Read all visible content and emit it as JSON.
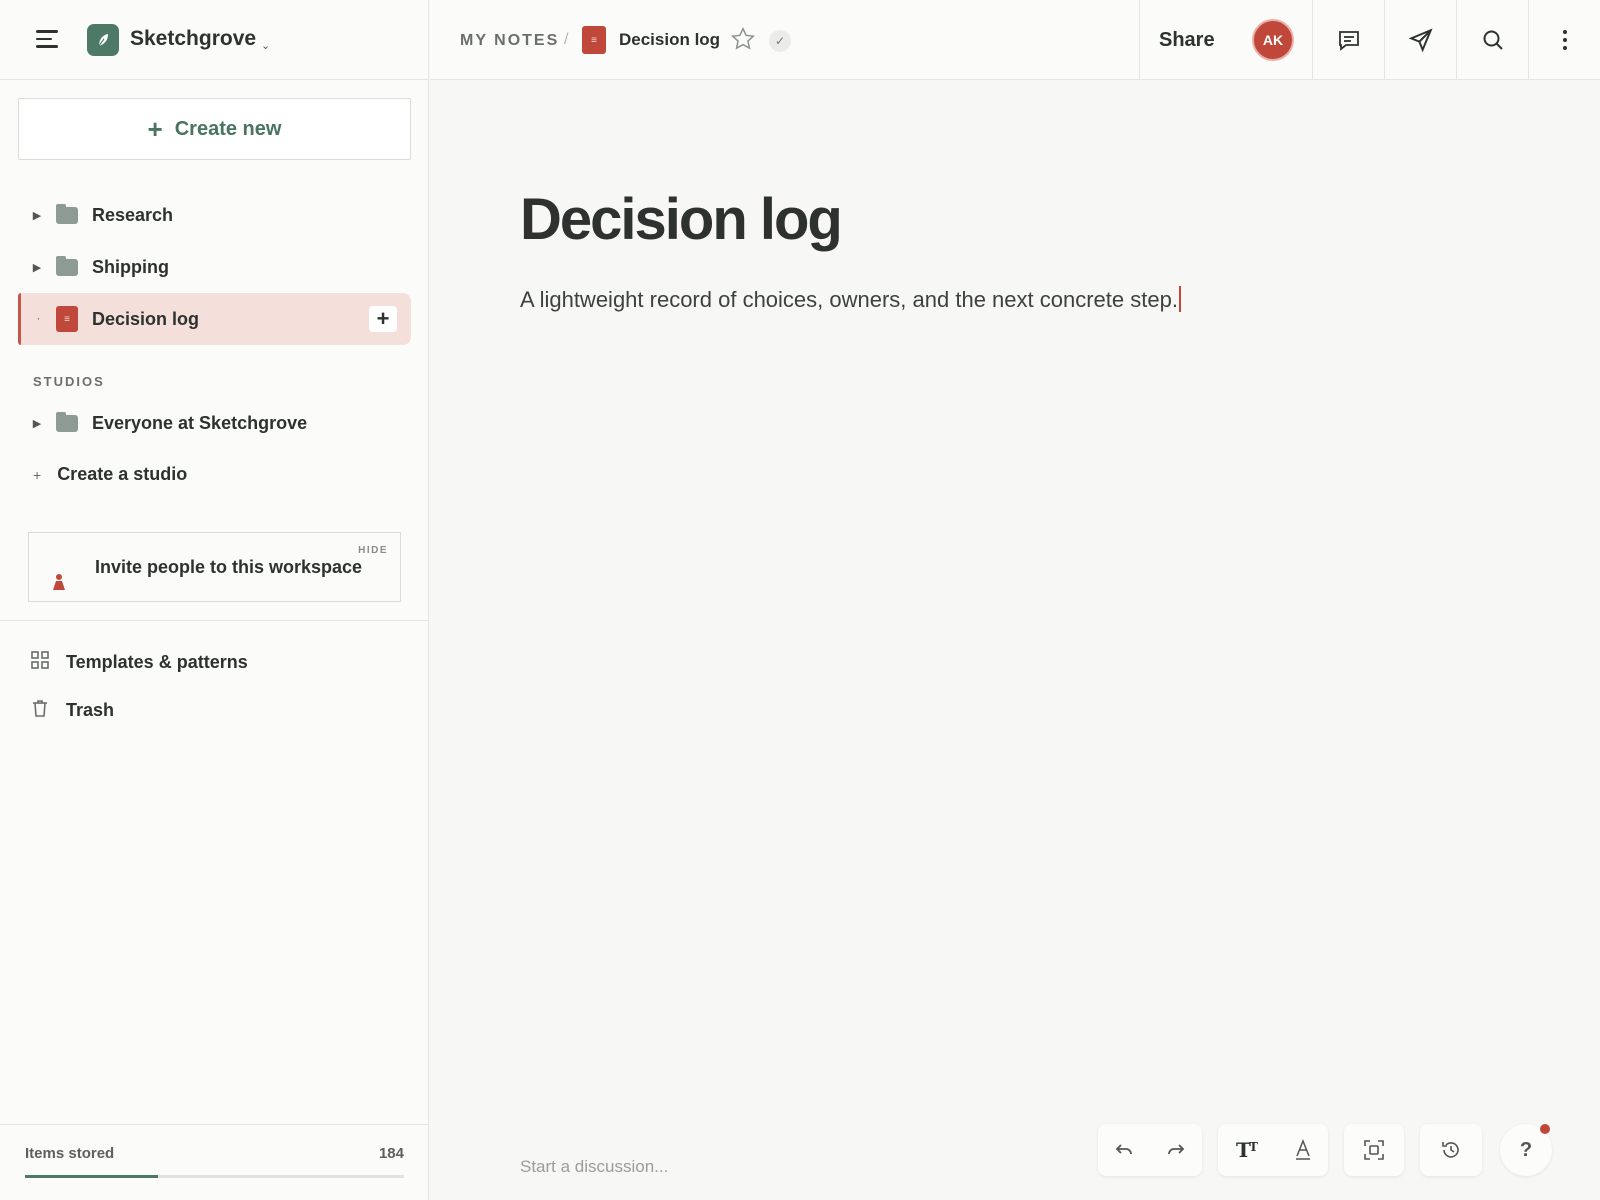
{
  "workspace": {
    "name": "Sketchgrove"
  },
  "sidebar": {
    "create_new_label": "Create new",
    "tree": [
      {
        "label": "Research"
      },
      {
        "label": "Shipping"
      },
      {
        "label": "Decision log"
      }
    ],
    "studios_label": "STUDIOS",
    "studios": [
      {
        "label": "Everyone at Sketchgrove"
      }
    ],
    "create_studio_label": "Create a studio",
    "invite": {
      "hide_label": "HIDE",
      "text": "Invite people to this workspace"
    },
    "links": [
      {
        "label": "Templates & patterns",
        "icon": "grid-icon"
      },
      {
        "label": "Trash",
        "icon": "trash-icon"
      }
    ],
    "storage": {
      "label": "Items stored",
      "count": "184",
      "progress_fraction": 0.35
    }
  },
  "breadcrumb": {
    "root": "MY NOTES",
    "separator": "/",
    "doc_title": "Decision log"
  },
  "topbar": {
    "share_label": "Share",
    "avatar_initials": "AK"
  },
  "document": {
    "title": "Decision log",
    "subtitle": "A lightweight record of choices, owners, and the next concrete step."
  },
  "discussion_placeholder": "Start a discussion...",
  "help_label": "?",
  "colors": {
    "accent_green": "#4c7a66",
    "accent_red": "#c0483b",
    "active_bg": "#f5dfda"
  }
}
